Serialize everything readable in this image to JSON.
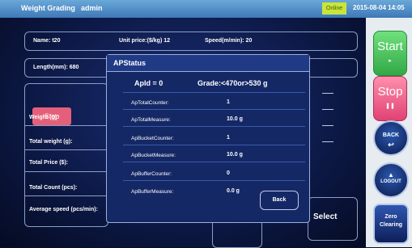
{
  "topbar": {
    "title": "Weight Grading",
    "user": "admin",
    "status": "Online",
    "datetime": "2015-08-04 14:05"
  },
  "info": {
    "name": "Name: t20",
    "unit_price": "Unit price:($/kg) 12",
    "speed": "Speed(m/min): 20",
    "length": "Length(mm): 680"
  },
  "left": {
    "stop": "Stop",
    "weight": "Weight (g):",
    "total_weight": "Total weight (g):",
    "total_price": "Total Price ($):",
    "total_count": "Total Count (pcs):",
    "avg_speed": "Average speed (pcs/min):"
  },
  "right_values": [
    "---",
    "---",
    "---",
    "---"
  ],
  "dialog": {
    "title": "APStatus",
    "apid": "ApId = 0",
    "grade": "Grade:<470or>530 g",
    "rows": [
      {
        "label": "ApTotalCounter:",
        "value": "1"
      },
      {
        "label": "ApTotalMeasure:",
        "value": "10.0 g"
      },
      {
        "label": "ApBucketCounter:",
        "value": "1"
      },
      {
        "label": "ApBucketMeasure:",
        "value": "10.0 g"
      },
      {
        "label": "ApBufferCounter:",
        "value": "0"
      },
      {
        "label": "ApBufferMeasure:",
        "value": "0.0 g"
      }
    ],
    "back": "Back"
  },
  "bottom": {
    "select": "Select"
  },
  "side": {
    "start": "Start",
    "stop": "Stop",
    "back": "BACK",
    "logout": "LOGOUT",
    "zero": "Zero Clearing"
  },
  "colors": {
    "accent": "#3e78b8",
    "start_green": "#46c25a",
    "stop_pink": "#ec5a86",
    "status": "#c8e63a"
  }
}
